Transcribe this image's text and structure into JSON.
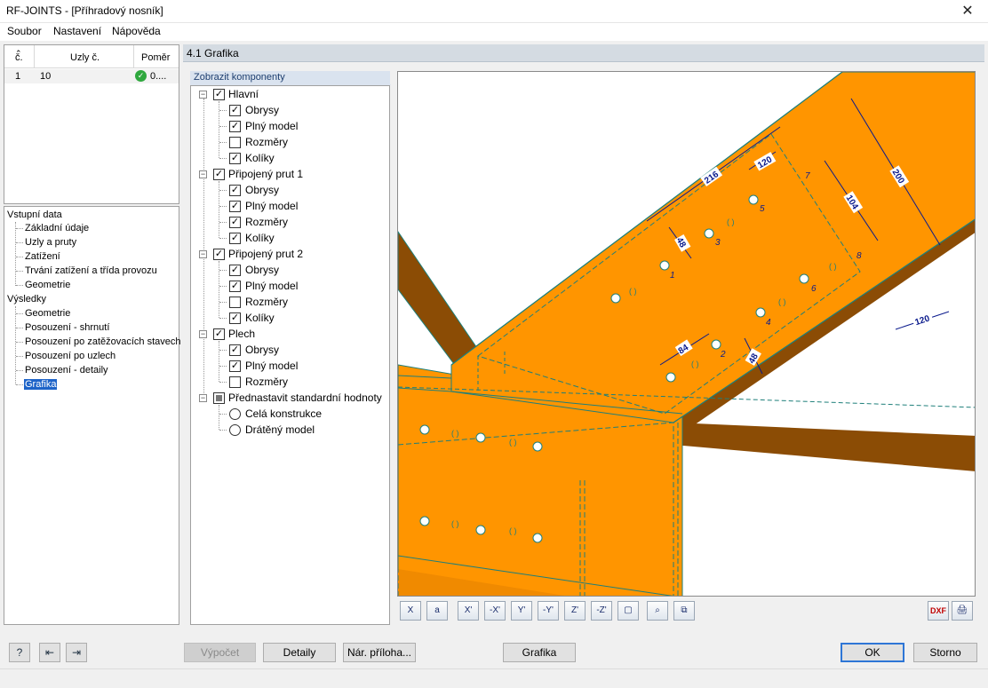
{
  "window": {
    "title": "RF-JOINTS - [Příhradový nosník]",
    "close_glyph": "✕"
  },
  "menu": [
    {
      "label": "Soubor"
    },
    {
      "label": "Nastavení"
    },
    {
      "label": "Nápověda"
    }
  ],
  "node_table": {
    "headers": [
      "č.",
      "Uzly č.",
      "Poměr"
    ],
    "rows": [
      {
        "no": "1",
        "nodes": "10",
        "ratio": "0....",
        "status_icon": "check-icon"
      }
    ]
  },
  "navigation": {
    "groups": [
      {
        "label": "Vstupní data",
        "items": [
          "Základní údaje",
          "Uzly a pruty",
          "Zatížení",
          "Trvání zatížení a třída provozu",
          "Geometrie"
        ]
      },
      {
        "label": "Výsledky",
        "items": [
          "Geometrie",
          "Posouzení - shrnutí",
          "Posouzení po zatěžovacích stavech",
          "Posouzení po uzlech",
          "Posouzení - detaily",
          "Grafika"
        ]
      }
    ],
    "selected": "Grafika"
  },
  "section_header": "4.1 Grafika",
  "components": {
    "tab_label": "Zobrazit komponenty",
    "groups": [
      {
        "label": "Hlavní",
        "checked": true,
        "items": [
          {
            "label": "Obrysy",
            "checked": true
          },
          {
            "label": "Plný model",
            "checked": true
          },
          {
            "label": "Rozměry",
            "checked": false
          },
          {
            "label": "Kolíky",
            "checked": true
          }
        ]
      },
      {
        "label": "Připojený prut 1",
        "checked": true,
        "items": [
          {
            "label": "Obrysy",
            "checked": true
          },
          {
            "label": "Plný model",
            "checked": true
          },
          {
            "label": "Rozměry",
            "checked": true
          },
          {
            "label": "Kolíky",
            "checked": true
          }
        ]
      },
      {
        "label": "Připojený prut 2",
        "checked": true,
        "items": [
          {
            "label": "Obrysy",
            "checked": true
          },
          {
            "label": "Plný model",
            "checked": true
          },
          {
            "label": "Rozměry",
            "checked": false
          },
          {
            "label": "Kolíky",
            "checked": true
          }
        ]
      },
      {
        "label": "Plech",
        "checked": true,
        "items": [
          {
            "label": "Obrysy",
            "checked": true
          },
          {
            "label": "Plný model",
            "checked": true
          },
          {
            "label": "Rozměry",
            "checked": false
          }
        ]
      },
      {
        "label": "Přednastavit standardní hodnoty",
        "indeterminate": true,
        "items": [
          {
            "label": "Celá konstrukce",
            "radio": true
          },
          {
            "label": "Drátěný model",
            "radio": true
          }
        ]
      }
    ]
  },
  "graphic": {
    "dimensions": [
      "216",
      "120",
      "200",
      "104",
      "48",
      "84",
      "48",
      "120"
    ],
    "pin_numbers": [
      "1",
      "2",
      "3",
      "4",
      "5",
      "6",
      "7",
      "8"
    ],
    "colors": {
      "wood": "#ff9500",
      "wood_dark": "#8b4c05",
      "edge": "#1e7f7a",
      "dim": "#0a1a8c"
    }
  },
  "toolbar": {
    "buttons": [
      "X",
      "a",
      "X'",
      "-X'",
      "Y'",
      "-Y'",
      "Z'",
      "-Z'",
      "▢",
      "⌕",
      "⧉"
    ],
    "right_buttons": [
      "DXF",
      "🖨"
    ]
  },
  "footer": {
    "calc": "Výpočet",
    "details": "Detaily",
    "appendix": "Nár. příloha...",
    "graphics": "Grafika",
    "ok": "OK",
    "cancel": "Storno"
  }
}
